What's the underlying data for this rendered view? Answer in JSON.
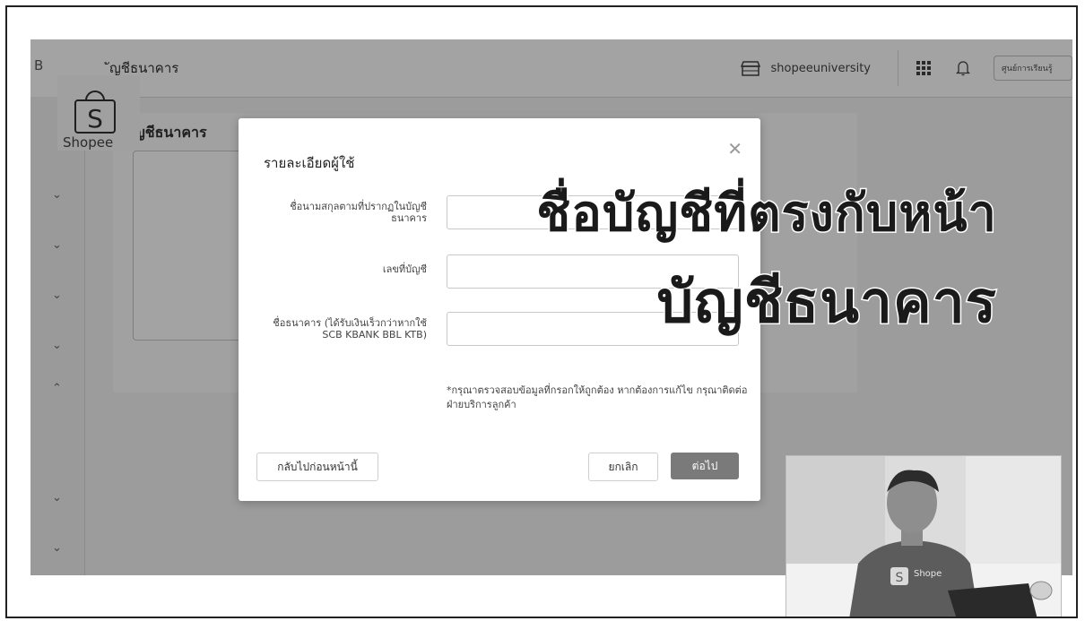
{
  "header": {
    "breadcrumb_fragment": "B",
    "title": "ัญชีธนาคาร",
    "shop_name": "shopeeuniversity",
    "education_button": "ศูนย์การเรียนรู้"
  },
  "logo": {
    "wordmark": "Shopee",
    "letter": "S"
  },
  "content": {
    "title": "บัญชีธนาคาร"
  },
  "modal": {
    "title": "รายละเอียดผู้ใช้",
    "close_icon": "close-icon",
    "fields": [
      {
        "label": "ชื่อนามสกุลตามที่ปรากฏในบัญชีธนาคาร",
        "value": ""
      },
      {
        "label": "เลขที่บัญชี",
        "value": ""
      },
      {
        "label": "ชื่อธนาคาร (ได้รับเงินเร็วกว่าหากใช้ SCB KBANK BBL KTB)",
        "value": ""
      }
    ],
    "note": "*กรุณาตรวจสอบข้อมูลที่กรอกให้ถูกต้อง หากต้องการแก้ไข กรุณาติดต่อฝ่ายบริการลูกค้า",
    "back_button": "กลับไปก่อนหน้านี้",
    "cancel_button": "ยกเลิก",
    "next_button": "ต่อไป"
  },
  "overlay": {
    "line1": "ชื่อบัญชีที่ตรงกับหน้า",
    "line2": "บัญชีธนาคาร"
  },
  "sidebar": {
    "chevrons": [
      "chevron-down-icon",
      "chevron-down-icon",
      "chevron-down-icon",
      "chevron-down-icon",
      "chevron-up-icon",
      "chevron-down-icon",
      "chevron-down-icon",
      "chevron-down-icon"
    ]
  },
  "webcam": {
    "shirt_text": "Shope"
  }
}
